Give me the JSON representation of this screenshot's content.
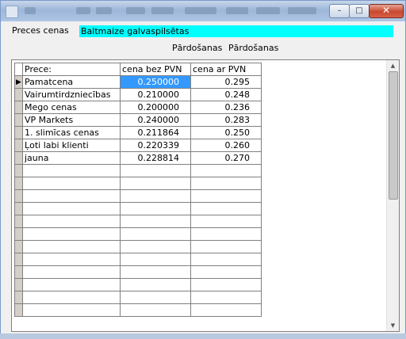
{
  "form": {
    "label": "Preces cenas",
    "product_name": "Baltmaize galvaspilsētas",
    "sub_headers": [
      "Pārdošanas",
      "Pārdošanas"
    ]
  },
  "grid": {
    "columns": [
      "Prece:",
      "cena bez PVN",
      "cena ar PVN"
    ],
    "rows": [
      {
        "name": "Pamatcena",
        "net": "0.250000",
        "gross": "0.295"
      },
      {
        "name": "Vairumtirdzniecības",
        "net": "0.210000",
        "gross": "0.248"
      },
      {
        "name": "Mego cenas",
        "net": "0.200000",
        "gross": "0.236"
      },
      {
        "name": "VP Markets",
        "net": "0.240000",
        "gross": "0.283"
      },
      {
        "name": "1. slimīcas cenas",
        "net": "0.211864",
        "gross": "0.250"
      },
      {
        "name": "Ļoti labi klienti",
        "net": "0.220339",
        "gross": "0.260"
      },
      {
        "name": "jauna",
        "net": "0.228814",
        "gross": "0.270"
      }
    ],
    "selected_row": 0,
    "current_row_marker": "▶"
  },
  "window_controls": {
    "minimize": "–",
    "maximize": "□",
    "close": "✕"
  },
  "icons": {
    "scroll_up": "▲",
    "scroll_down": "▼"
  }
}
